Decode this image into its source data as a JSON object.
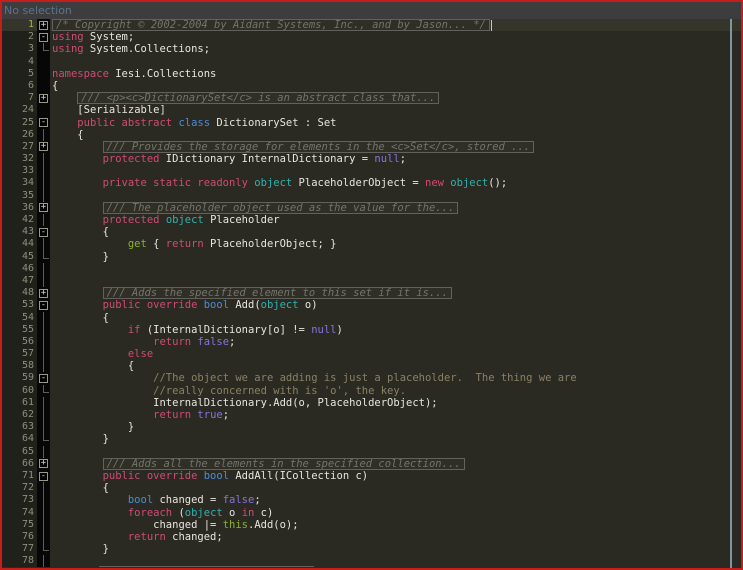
{
  "window": {
    "title": "No selection",
    "border_color": "#c81d1d"
  },
  "editor": {
    "colors": {
      "background": "#2a2a22",
      "gutter_bg": "#21211b",
      "fold_bg": "#070707",
      "current_line": "#35352b",
      "line_number": "#8f8f7d",
      "current_line_number": "#aab33f",
      "keyword": "#d04a76",
      "type": "#4a8cd6",
      "objectkw": "#2fb2ae",
      "value": "#8673dd",
      "green": "#8cb033",
      "plain": "#e6e6de",
      "comment": "#8a8065",
      "doc": "#74746a",
      "doc_border": "#62625a",
      "doc_bg": "#2f2f28",
      "titlebar_bg": "#3d3d3f",
      "title_text": "#5c7289",
      "border": "#c81d1d",
      "scrollbar": "#8195a1",
      "fold_line": "#5f5f55",
      "caret": "#c0c6c9"
    },
    "lines": [
      {
        "n": "1",
        "fold": "plus",
        "current": true,
        "box": true,
        "caret": true,
        "indent": 0,
        "seg": [
          [
            "d",
            "/* Copyright © 2002-2004 by Aidant Systems, Inc., and by Jason... */"
          ]
        ]
      },
      {
        "n": "2",
        "fold": "minus",
        "indent": 0,
        "seg": [
          [
            "k",
            "using"
          ],
          [
            "p",
            " System;"
          ]
        ]
      },
      {
        "n": "3",
        "fold": "end",
        "indent": 0,
        "seg": [
          [
            "k",
            "using"
          ],
          [
            "p",
            " System.Collections;"
          ]
        ]
      },
      {
        "n": "4",
        "fold": "none",
        "indent": 0,
        "seg": []
      },
      {
        "n": "5",
        "fold": "none",
        "indent": 0,
        "seg": [
          [
            "k",
            "namespace"
          ],
          [
            "p",
            " Iesi.Collections"
          ]
        ]
      },
      {
        "n": "6",
        "fold": "none",
        "indent": 0,
        "seg": [
          [
            "p",
            "{"
          ]
        ]
      },
      {
        "n": "7",
        "fold": "plus",
        "box": true,
        "indent": 4,
        "seg": [
          [
            "d",
            "/// <p><c>DictionarySet</c> is an abstract class that..."
          ]
        ]
      },
      {
        "n": "24",
        "fold": "none",
        "indent": 4,
        "seg": [
          [
            "p",
            "[Serializable]"
          ]
        ]
      },
      {
        "n": "25",
        "fold": "minus",
        "indent": 4,
        "seg": [
          [
            "k",
            "public abstract "
          ],
          [
            "t",
            "class"
          ],
          [
            "p",
            " DictionarySet : Set"
          ]
        ]
      },
      {
        "n": "26",
        "fold": "line",
        "indent": 4,
        "seg": [
          [
            "p",
            "{"
          ]
        ]
      },
      {
        "n": "27",
        "fold": "plus",
        "box": true,
        "indent": 8,
        "seg": [
          [
            "d",
            "/// Provides the storage for elements in the <c>Set</c>, stored ..."
          ]
        ]
      },
      {
        "n": "32",
        "fold": "line",
        "indent": 8,
        "seg": [
          [
            "k",
            "protected"
          ],
          [
            "p",
            " IDictionary InternalDictionary = "
          ],
          [
            "v",
            "null"
          ],
          [
            "p",
            ";"
          ]
        ]
      },
      {
        "n": "33",
        "fold": "line",
        "indent": 0,
        "seg": []
      },
      {
        "n": "34",
        "fold": "line",
        "indent": 8,
        "seg": [
          [
            "k",
            "private static readonly "
          ],
          [
            "o",
            "object"
          ],
          [
            "p",
            " PlaceholderObject = "
          ],
          [
            "k",
            "new"
          ],
          [
            "p",
            " "
          ],
          [
            "o",
            "object"
          ],
          [
            "p",
            "();"
          ]
        ]
      },
      {
        "n": "35",
        "fold": "line",
        "indent": 0,
        "seg": []
      },
      {
        "n": "36",
        "fold": "plus",
        "box": true,
        "indent": 8,
        "seg": [
          [
            "d",
            "/// The placeholder object used as the value for the..."
          ]
        ]
      },
      {
        "n": "42",
        "fold": "line",
        "indent": 8,
        "seg": [
          [
            "k",
            "protected"
          ],
          [
            "p",
            " "
          ],
          [
            "o",
            "object"
          ],
          [
            "p",
            " Placeholder"
          ]
        ]
      },
      {
        "n": "43",
        "fold": "minus",
        "indent": 8,
        "seg": [
          [
            "p",
            "{"
          ]
        ]
      },
      {
        "n": "44",
        "fold": "line",
        "indent": 12,
        "seg": [
          [
            "g",
            "get"
          ],
          [
            "p",
            " { "
          ],
          [
            "k",
            "return"
          ],
          [
            "p",
            " PlaceholderObject; }"
          ]
        ]
      },
      {
        "n": "45",
        "fold": "end",
        "indent": 8,
        "seg": [
          [
            "p",
            "}"
          ]
        ]
      },
      {
        "n": "46",
        "fold": "line",
        "indent": 0,
        "seg": []
      },
      {
        "n": "47",
        "fold": "line",
        "indent": 0,
        "seg": []
      },
      {
        "n": "48",
        "fold": "plus",
        "box": true,
        "indent": 8,
        "seg": [
          [
            "d",
            "/// Adds the specified element to this set if it is..."
          ]
        ]
      },
      {
        "n": "53",
        "fold": "minus",
        "indent": 8,
        "seg": [
          [
            "k",
            "public override "
          ],
          [
            "t",
            "bool"
          ],
          [
            "p",
            " Add("
          ],
          [
            "o",
            "object"
          ],
          [
            "p",
            " o)"
          ]
        ]
      },
      {
        "n": "54",
        "fold": "line",
        "indent": 8,
        "seg": [
          [
            "p",
            "{"
          ]
        ]
      },
      {
        "n": "55",
        "fold": "line",
        "indent": 12,
        "seg": [
          [
            "k",
            "if"
          ],
          [
            "p",
            " (InternalDictionary[o] != "
          ],
          [
            "v",
            "null"
          ],
          [
            "p",
            ")"
          ]
        ]
      },
      {
        "n": "56",
        "fold": "line",
        "indent": 16,
        "seg": [
          [
            "k",
            "return"
          ],
          [
            "p",
            " "
          ],
          [
            "v",
            "false"
          ],
          [
            "p",
            ";"
          ]
        ]
      },
      {
        "n": "57",
        "fold": "line",
        "indent": 12,
        "seg": [
          [
            "k",
            "else"
          ]
        ]
      },
      {
        "n": "58",
        "fold": "line",
        "indent": 12,
        "seg": [
          [
            "p",
            "{"
          ]
        ]
      },
      {
        "n": "59",
        "fold": "minus",
        "indent": 16,
        "seg": [
          [
            "c",
            "//The object we are adding is just a placeholder.  The thing we are"
          ]
        ]
      },
      {
        "n": "60",
        "fold": "end",
        "indent": 16,
        "seg": [
          [
            "c",
            "//really concerned with is 'o', the key."
          ]
        ]
      },
      {
        "n": "61",
        "fold": "line",
        "indent": 16,
        "seg": [
          [
            "p",
            "InternalDictionary.Add(o, PlaceholderObject);"
          ]
        ]
      },
      {
        "n": "62",
        "fold": "line",
        "indent": 16,
        "seg": [
          [
            "k",
            "return"
          ],
          [
            "p",
            " "
          ],
          [
            "v",
            "true"
          ],
          [
            "p",
            ";"
          ]
        ]
      },
      {
        "n": "63",
        "fold": "line",
        "indent": 12,
        "seg": [
          [
            "p",
            "}"
          ]
        ]
      },
      {
        "n": "64",
        "fold": "end",
        "indent": 8,
        "seg": [
          [
            "p",
            "}"
          ]
        ]
      },
      {
        "n": "65",
        "fold": "line",
        "indent": 0,
        "seg": []
      },
      {
        "n": "66",
        "fold": "plus",
        "box": true,
        "indent": 8,
        "seg": [
          [
            "d",
            "/// Adds all the elements in the specified collection..."
          ]
        ]
      },
      {
        "n": "71",
        "fold": "minus",
        "indent": 8,
        "seg": [
          [
            "k",
            "public override "
          ],
          [
            "t",
            "bool"
          ],
          [
            "p",
            " AddAll(ICollection c)"
          ]
        ]
      },
      {
        "n": "72",
        "fold": "line",
        "indent": 8,
        "seg": [
          [
            "p",
            "{"
          ]
        ]
      },
      {
        "n": "73",
        "fold": "line",
        "indent": 12,
        "seg": [
          [
            "t",
            "bool"
          ],
          [
            "p",
            " changed = "
          ],
          [
            "v",
            "false"
          ],
          [
            "p",
            ";"
          ]
        ]
      },
      {
        "n": "74",
        "fold": "line",
        "indent": 12,
        "seg": [
          [
            "k",
            "foreach"
          ],
          [
            "p",
            " ("
          ],
          [
            "o",
            "object"
          ],
          [
            "p",
            " o "
          ],
          [
            "k",
            "in"
          ],
          [
            "p",
            " c)"
          ]
        ]
      },
      {
        "n": "75",
        "fold": "line",
        "indent": 16,
        "seg": [
          [
            "p",
            "changed |= "
          ],
          [
            "g",
            "this"
          ],
          [
            "p",
            ".Add(o);"
          ]
        ]
      },
      {
        "n": "76",
        "fold": "line",
        "indent": 12,
        "seg": [
          [
            "k",
            "return"
          ],
          [
            "p",
            " changed;"
          ]
        ]
      },
      {
        "n": "77",
        "fold": "end",
        "indent": 8,
        "seg": [
          [
            "p",
            "}"
          ]
        ]
      },
      {
        "n": "78",
        "fold": "line",
        "indent": 8,
        "boxtop": true,
        "seg": []
      }
    ]
  }
}
